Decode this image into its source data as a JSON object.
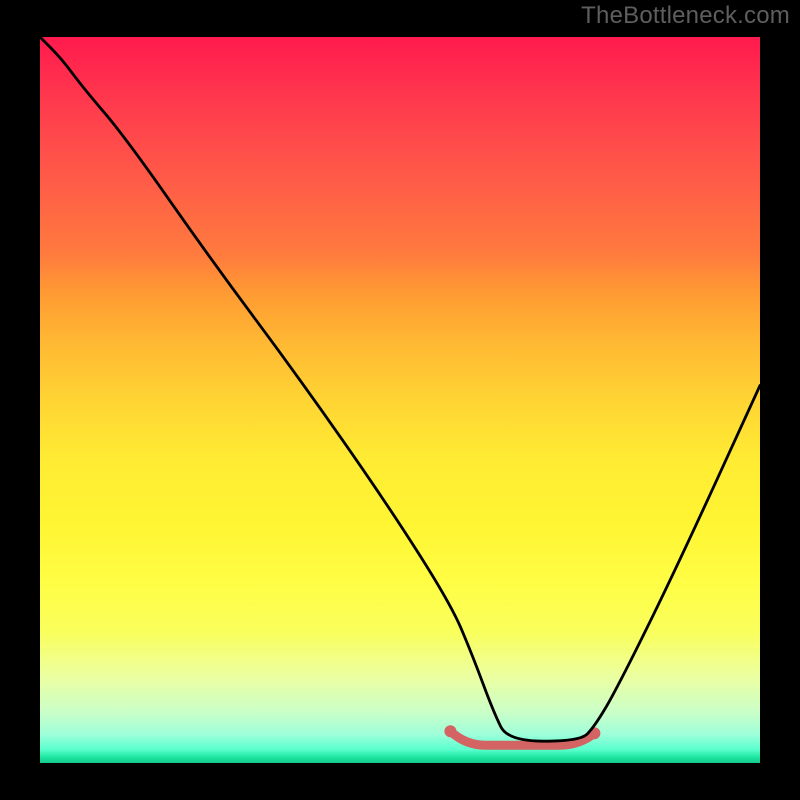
{
  "watermark": "TheBottleneck.com",
  "colors": {
    "curve": "#000000",
    "region": "#d46464",
    "top": "#ff1a4d",
    "bottom": "#14c98c"
  },
  "chart_data": {
    "type": "line",
    "title": "",
    "xlabel": "",
    "ylabel": "",
    "xlim": [
      0,
      100
    ],
    "ylim": [
      0,
      100
    ],
    "series": [
      {
        "name": "bottleneck-curve",
        "x": [
          0,
          3,
          6,
          12,
          24,
          36,
          48,
          57,
          60,
          63,
          65,
          75,
          77,
          80,
          88,
          100
        ],
        "y": [
          100,
          97,
          93,
          86,
          69,
          53,
          36,
          22,
          15,
          7,
          3,
          3,
          5,
          10,
          26,
          52
        ],
        "note": "Values in percent of plot area; y=100 is top, y=0 is bottom. Minimum plateau ~3% between x≈63 and x≈76."
      }
    ],
    "highlight_region": {
      "name": "optimal-region",
      "x_start": 57,
      "x_end": 77,
      "y": 3,
      "color": "#d46464",
      "note": "Short rounded segment drawn along the valley floor in muted red."
    },
    "grid": false,
    "legend": false
  }
}
